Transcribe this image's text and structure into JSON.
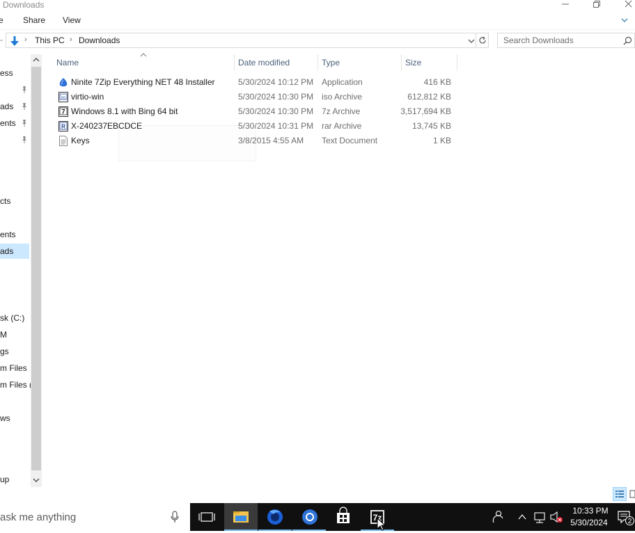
{
  "window": {
    "title": "Downloads"
  },
  "ribbon": {
    "tabs": [
      "e",
      "Share",
      "View"
    ]
  },
  "address": {
    "path": [
      "This PC",
      "Downloads"
    ]
  },
  "search": {
    "placeholder": "Search Downloads"
  },
  "nav": {
    "items": [
      {
        "label": "ess",
        "pinned": false,
        "selected": false
      },
      {
        "label": "ads",
        "pinned": true,
        "selected": false
      },
      {
        "label": "ents",
        "pinned": true,
        "selected": false
      },
      {
        "label": "cts",
        "pinned": false,
        "selected": false
      },
      {
        "label": "ents",
        "pinned": false,
        "selected": false
      },
      {
        "label": "ads",
        "pinned": false,
        "selected": true
      },
      {
        "label": "sk (C:)",
        "pinned": false,
        "selected": false
      },
      {
        "label": "M",
        "pinned": false,
        "selected": false
      },
      {
        "label": "gs",
        "pinned": false,
        "selected": false
      },
      {
        "label": "m Files",
        "pinned": false,
        "selected": false
      },
      {
        "label": "m Files (",
        "pinned": false,
        "selected": false
      },
      {
        "label": "ws",
        "pinned": false,
        "selected": false
      },
      {
        "label": "up",
        "pinned": false,
        "selected": false
      }
    ]
  },
  "columns": {
    "name": "Name",
    "date": "Date modified",
    "type": "Type",
    "size": "Size"
  },
  "files": [
    {
      "name": "Ninite 7Zip Everything NET 48 Installer",
      "date": "5/30/2024 10:12 PM",
      "type": "Application",
      "size": "416 KB",
      "icon": "ninite-app-icon"
    },
    {
      "name": "virtio-win",
      "date": "5/30/2024 10:30 PM",
      "type": "iso Archive",
      "size": "612,812 KB",
      "icon": "iso-archive-icon"
    },
    {
      "name": "Windows 8.1 with Bing 64 bit",
      "date": "5/30/2024 10:30 PM",
      "type": "7z Archive",
      "size": "3,517,694 KB",
      "icon": "7z-archive-icon"
    },
    {
      "name": "X-240237EBCDCE",
      "date": "5/30/2024 10:31 PM",
      "type": "rar Archive",
      "size": "13,745 KB",
      "icon": "rar-archive-icon"
    },
    {
      "name": "Keys",
      "date": "3/8/2015 4:55 AM",
      "type": "Text Document",
      "size": "1 KB",
      "icon": "text-document-icon"
    }
  ],
  "taskbar": {
    "search_text": "ask me anything",
    "apps": [
      "file-explorer",
      "firefox",
      "chrome",
      "store",
      "7zip"
    ],
    "clock_time": "10:33 PM",
    "clock_date": "5/30/2024",
    "notification_count": "2"
  },
  "colors": {
    "selection": "#cce8ff",
    "header_text": "#4c607a",
    "taskbar": "#101010",
    "accent_underline": "#76b9ed"
  }
}
